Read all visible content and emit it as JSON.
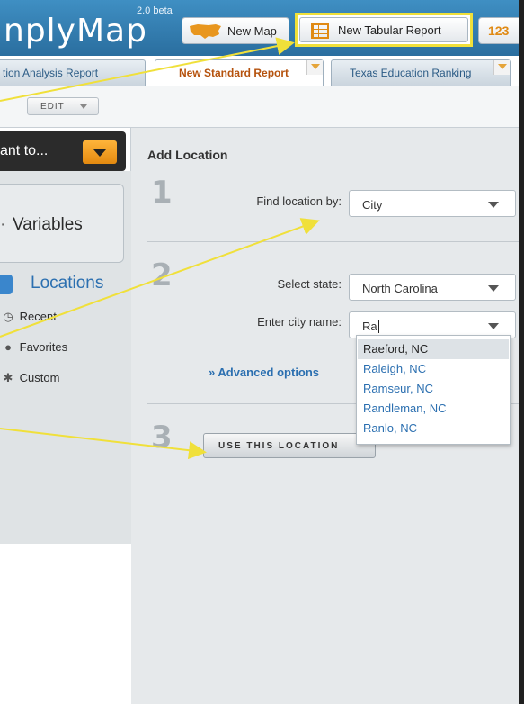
{
  "header": {
    "logo_text": "nplyMap",
    "beta_label": "2.0 beta",
    "new_map_label": "New Map",
    "new_tabular_label": "New Tabular Report",
    "partial_button_label": "123"
  },
  "tabs": [
    {
      "label": "tion Analysis Report"
    },
    {
      "label": "New Standard Report"
    },
    {
      "label": "Texas Education Ranking"
    }
  ],
  "toolbar": {
    "edit_label": "EDIT"
  },
  "sidebar": {
    "want_label": "ant to...",
    "variables_label": "Variables",
    "locations_label": "Locations",
    "items": [
      {
        "label": "Recent",
        "icon": "clock-icon"
      },
      {
        "label": "Favorites",
        "icon": "heart-icon"
      },
      {
        "label": "Custom",
        "icon": "asterisk-icon"
      }
    ]
  },
  "main": {
    "title": "Add Location",
    "steps": [
      "1",
      "2",
      "3"
    ],
    "find_by_label": "Find location by:",
    "find_by_value": "City",
    "state_label": "Select state:",
    "state_value": "North Carolina",
    "city_label": "Enter city name:",
    "city_value": "Ra",
    "advanced_label": "» Advanced options",
    "use_button_label": "USE THIS LOCATION",
    "suggestions": [
      "Raeford, NC",
      "Raleigh, NC",
      "Ramseur, NC",
      "Randleman, NC",
      "Ranlo, NC"
    ]
  },
  "colors": {
    "header_blue": "#3f8fc3",
    "highlight_yellow": "#f0e03a",
    "accent_orange": "#e48a10",
    "link_blue": "#2b6fb0"
  }
}
